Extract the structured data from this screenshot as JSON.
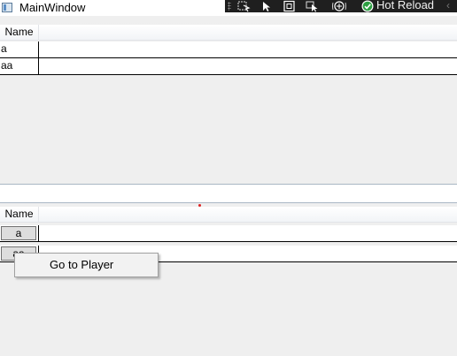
{
  "window": {
    "title": "MainWindow"
  },
  "devtools": {
    "hot_reload_label": "Hot Reload",
    "icons": [
      "select-element-icon",
      "pointer-icon",
      "layout-bounds-icon",
      "track-focus-icon",
      "binding-icon",
      "hot-reload-check-icon",
      "chevron-left-icon"
    ],
    "hot_reload_color": "#2ea043"
  },
  "top_grid": {
    "column_header": "Name",
    "rows": [
      "a",
      "aa"
    ]
  },
  "bottom_grid": {
    "column_header": "Name",
    "rows": [
      "a",
      "aa"
    ]
  },
  "context_menu": {
    "items": [
      "Go to Player"
    ]
  }
}
